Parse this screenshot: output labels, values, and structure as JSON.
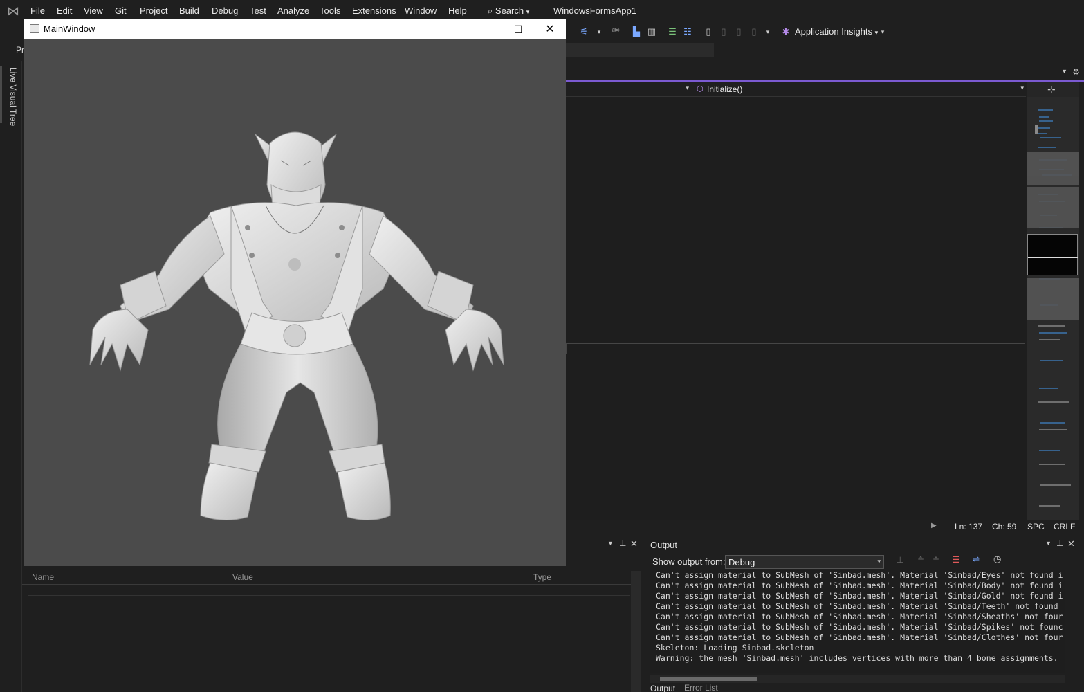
{
  "menubar": {
    "items": [
      "File",
      "Edit",
      "View",
      "Git",
      "Project",
      "Build",
      "Debug",
      "Test",
      "Analyze",
      "Tools",
      "Extensions",
      "Window",
      "Help"
    ],
    "search": "Search",
    "app_title": "WindowsFormsApp1"
  },
  "toolbar": {
    "app_insights": "Application Insights",
    "row2_label": "Pr"
  },
  "left_strip": {
    "live_visual_tree": "Live Visual Tree"
  },
  "editor": {
    "nav_method": "Initialize()",
    "status": {
      "line": "Ln: 137",
      "col": "Ch: 59",
      "indent": "SPC",
      "eol": "CRLF"
    }
  },
  "watch": {
    "columns": [
      "Name",
      "Value",
      "Type"
    ]
  },
  "output": {
    "title": "Output",
    "show_from_label": "Show output from:",
    "show_from_value": "Debug",
    "lines": [
      "Can't assign material to SubMesh of 'Sinbad.mesh'. Material 'Sinbad/Eyes' not found i",
      "Can't assign material to SubMesh of 'Sinbad.mesh'. Material 'Sinbad/Body' not found i",
      "Can't assign material to SubMesh of 'Sinbad.mesh'. Material 'Sinbad/Gold' not found i",
      "Can't assign material to SubMesh of 'Sinbad.mesh'. Material 'Sinbad/Teeth' not found",
      "Can't assign material to SubMesh of 'Sinbad.mesh'. Material 'Sinbad/Sheaths' not four",
      "Can't assign material to SubMesh of 'Sinbad.mesh'. Material 'Sinbad/Spikes' not founc",
      "Can't assign material to SubMesh of 'Sinbad.mesh'. Material 'Sinbad/Clothes' not four",
      "Skeleton: Loading Sinbad.skeleton",
      "Warning: the mesh 'Sinbad.mesh' includes vertices with more than 4 bone assignments."
    ],
    "tabs": [
      "Output",
      "Error List"
    ]
  },
  "main_window": {
    "title": "MainWindow"
  },
  "colors": {
    "accent": "#7b5ad1",
    "background": "#1f1f1f",
    "viewport": "#4b4b4b",
    "model": "#d8d8d8"
  }
}
